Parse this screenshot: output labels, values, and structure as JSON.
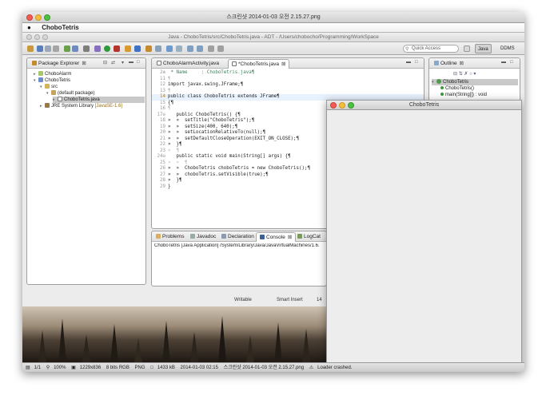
{
  "viewer": {
    "window_title": "스크린샷 2014-01-03 오전 2.15.27.png",
    "status": {
      "page": "1/1",
      "zoom": "100%",
      "dims": "1229x836",
      "color": "8 bits RGB",
      "format": "PNG",
      "size": "1433 kB",
      "date": "2014-01-03 02:15",
      "filename": "스크린샷 2014-01-03 오전 2.15.27.png",
      "warning": "Loader crashed."
    }
  },
  "menubar": {
    "app_name": "ChoboTetris"
  },
  "eclipse": {
    "title": "Java - ChoboTetris/src/ChoboTetris.java - ADT - /Users/chobocho/Programming/WorkSpace",
    "quick_access": "Quick Access",
    "perspectives": [
      "Java",
      "DDMS"
    ]
  },
  "package_explorer": {
    "tab_label": "Package Explorer",
    "items": [
      {
        "label": "ChoboAlarm",
        "depth": 0,
        "selected": false
      },
      {
        "label": "ChoboTetris",
        "depth": 0,
        "selected": false
      },
      {
        "label": "src",
        "depth": 1,
        "selected": false
      },
      {
        "label": "(default package)",
        "depth": 2,
        "selected": false
      },
      {
        "label": "ChoboTetris.java",
        "depth": 3,
        "selected": true
      },
      {
        "label": "JRE System Library",
        "suffix": "[JavaSE-1.6]",
        "depth": 1,
        "selected": false
      }
    ]
  },
  "editor": {
    "tabs": [
      {
        "label": "ChoboAlarmActivity.java",
        "active": false
      },
      {
        "label": "*ChoboTetris.java",
        "active": true
      }
    ],
    "lines": [
      {
        "n": "2⊕",
        "text": " * Name     : ChoboTetris.java¶"
      },
      {
        "n": "11",
        "text": "¶"
      },
      {
        "n": "12",
        "text": "import javax.swing.JFrame;¶"
      },
      {
        "n": "13",
        "text": "¶"
      },
      {
        "n": "14",
        "text": "public class ChoboTetris extends JFrame¶"
      },
      {
        "n": "15",
        "text": "{¶"
      },
      {
        "n": "16",
        "text": "¶"
      },
      {
        "n": "17⊖",
        "text": "   public ChoboTetris() {¶"
      },
      {
        "n": "18",
        "text": "»  »  setTitle(\"ChoboTetris\");¶"
      },
      {
        "n": "19",
        "text": "»  »  setSize(400, 640);¶"
      },
      {
        "n": "20",
        "text": "»  »  setLocationRelativeTo(null);¶"
      },
      {
        "n": "21",
        "text": "»  »  setDefaultCloseOperation(EXIT_ON_CLOSE);¶"
      },
      {
        "n": "22",
        "text": "»  }¶"
      },
      {
        "n": "23",
        "text": "»  ¶"
      },
      {
        "n": "24⊖",
        "text": "   public static void main(String[] args) {¶"
      },
      {
        "n": "25",
        "text": "»  »  ¶"
      },
      {
        "n": "26",
        "text": "»  »  ChoboTetris choboTetris = new ChoboTetris();¶"
      },
      {
        "n": "27",
        "text": "»  »  choboTetris.setVisible(true);¶"
      },
      {
        "n": "28",
        "text": "»  }¶"
      },
      {
        "n": "29",
        "text": "}"
      }
    ]
  },
  "outline": {
    "tab_label": "Outline",
    "items": [
      {
        "label": "ChoboTetris",
        "depth": 0
      },
      {
        "label": "ChoboTetris()",
        "depth": 1
      },
      {
        "label": "main(String[]) : void",
        "depth": 1
      }
    ]
  },
  "bottom_panel": {
    "tabs": [
      "Problems",
      "Javadoc",
      "Declaration",
      "Console",
      "LogCat"
    ],
    "active_tab": "Console",
    "console_text": "ChoboTetris [Java Application] /System/Library/Java/JavaVirtualMachines/1.6."
  },
  "statusbar": {
    "writable": "Writable",
    "insert": "Smart Insert",
    "position": "14"
  },
  "jframe": {
    "title": "ChoboTetris"
  }
}
